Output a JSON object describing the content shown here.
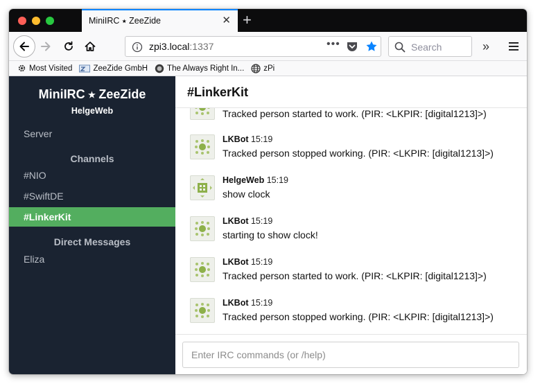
{
  "browser": {
    "tab_title": "MiniIRC ⭑ ZeeZide",
    "tab_close_glyph": "✕",
    "new_tab_glyph": "+",
    "url_host": "zpi3.local",
    "url_port": ":1337",
    "url_dots": "•••",
    "search_placeholder": "Search",
    "overflow_glyph": "»",
    "accent_color": "#0a84ff",
    "bookmarks": [
      {
        "label": "Most Visited",
        "icon": "gear-icon"
      },
      {
        "label": "ZeeZide GmbH",
        "icon": "zeezide-icon"
      },
      {
        "label": "The Always Right In...",
        "icon": "always-right-icon"
      },
      {
        "label": "zPi",
        "icon": "globe-icon"
      }
    ]
  },
  "sidebar": {
    "app_title": "MiniIRC ⭑ ZeeZide",
    "user": "HelgeWeb",
    "server_label": "Server",
    "channels_header": "Channels",
    "channels": [
      "#NIO",
      "#SwiftDE",
      "#LinkerKit"
    ],
    "active_channel": "#LinkerKit",
    "dm_header": "Direct Messages",
    "direct_messages": [
      "Eliza"
    ],
    "background_color": "#1a2331",
    "active_color": "#53ae5f"
  },
  "main": {
    "channel_title": "#LinkerKit",
    "messages": [
      {
        "nick": "",
        "time": "",
        "text": "Tracked person started to work. (PIR: <LKPIR: [digital1213]>)",
        "avatar": "lkbot-avatar"
      },
      {
        "nick": "LKBot",
        "time": "15:19",
        "text": "Tracked person stopped working. (PIR: <LKPIR: [digital1213]>)",
        "avatar": "lkbot-avatar"
      },
      {
        "nick": "HelgeWeb",
        "time": "15:19",
        "text": "show clock",
        "avatar": "helgeweb-avatar"
      },
      {
        "nick": "LKBot",
        "time": "15:19",
        "text": "starting to show clock!",
        "avatar": "lkbot-avatar"
      },
      {
        "nick": "LKBot",
        "time": "15:19",
        "text": "Tracked person started to work. (PIR: <LKPIR: [digital1213]>)",
        "avatar": "lkbot-avatar"
      },
      {
        "nick": "LKBot",
        "time": "15:19",
        "text": "Tracked person stopped working. (PIR: <LKPIR: [digital1213]>)",
        "avatar": "lkbot-avatar"
      }
    ],
    "input_placeholder": "Enter IRC commands (or /help)"
  }
}
